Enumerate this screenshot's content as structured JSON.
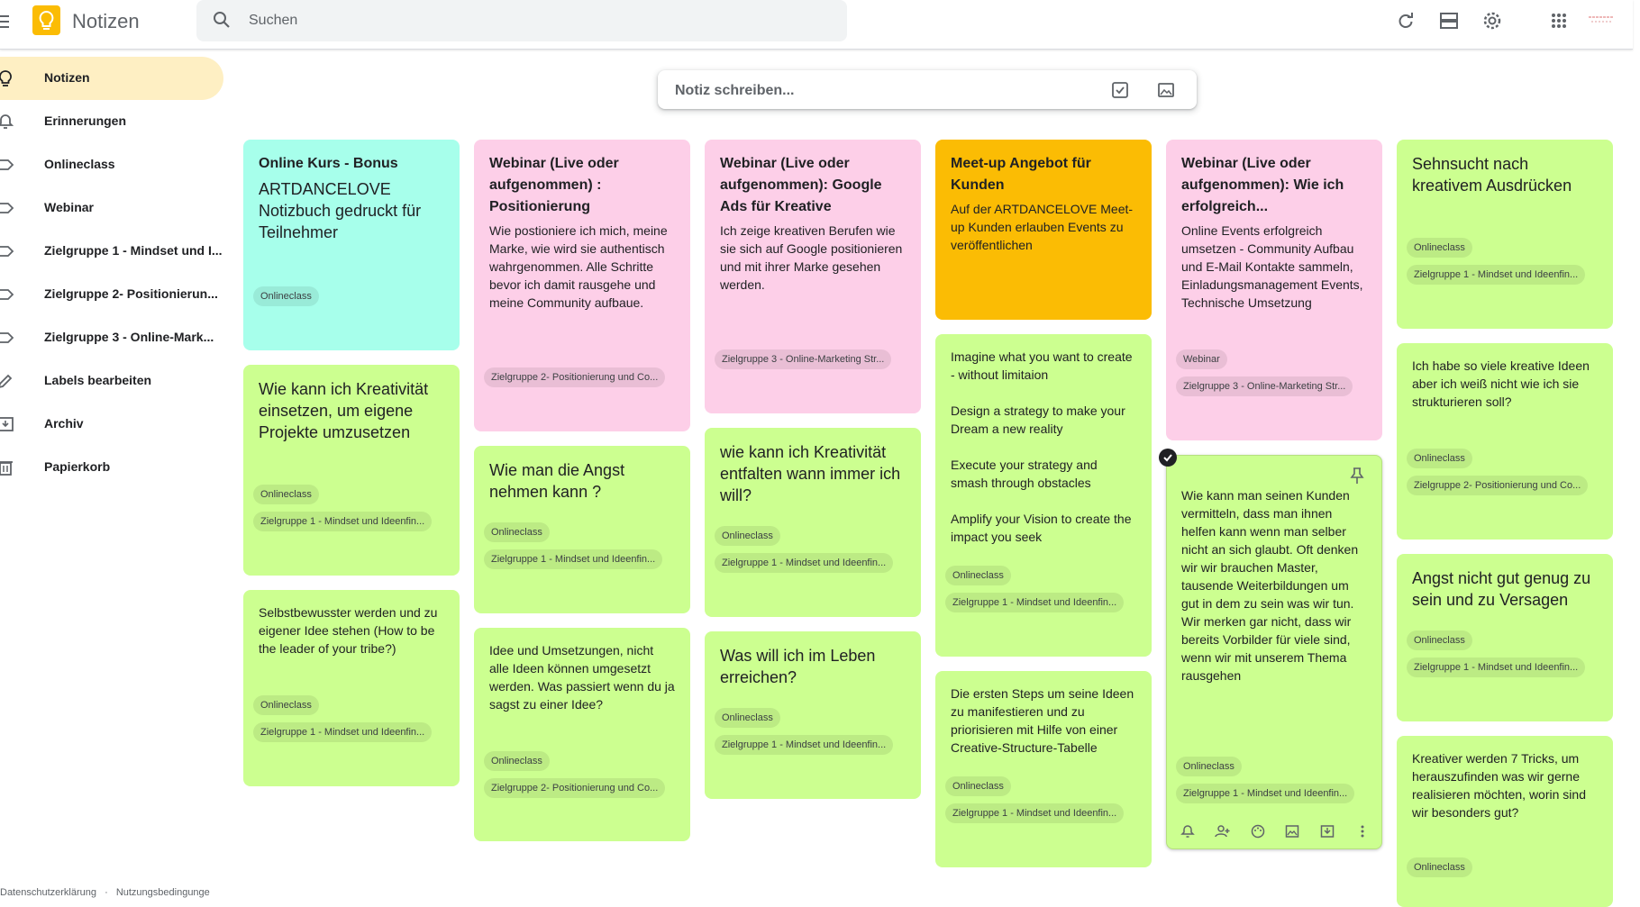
{
  "app": {
    "title": "Notizen"
  },
  "search": {
    "placeholder": "Suchen"
  },
  "take_note": {
    "placeholder": "Notiz schreiben..."
  },
  "sidebar": {
    "items": [
      {
        "label": "Notizen",
        "icon": "lightbulb-icon",
        "active": true
      },
      {
        "label": "Erinnerungen",
        "icon": "bell-icon"
      },
      {
        "label": "Onlineclass",
        "icon": "label-icon"
      },
      {
        "label": "Webinar",
        "icon": "label-icon"
      },
      {
        "label": "Zielgruppe 1 - Mindset und I...",
        "icon": "label-icon"
      },
      {
        "label": "Zielgruppe 2- Positionierun...",
        "icon": "label-icon"
      },
      {
        "label": "Zielgruppe 3 - Online-Mark...",
        "icon": "label-icon"
      },
      {
        "label": "Labels bearbeiten",
        "icon": "pencil-icon"
      },
      {
        "label": "Archiv",
        "icon": "archive-icon"
      },
      {
        "label": "Papierkorb",
        "icon": "trash-icon"
      }
    ]
  },
  "footer": {
    "privacy": "Datenschutzerklärung",
    "separator": "·",
    "terms": "Nutzungsbedingunge"
  },
  "notes": [
    {
      "title": "Online Kurs - Bonus",
      "text": "ARTDANCELOVE Notizbuch gedruckt für Teilnehmer",
      "labels": [
        "Onlineclass"
      ],
      "color": "#a7ffeb"
    },
    {
      "title": "Webinar (Live oder aufgenommen) : Positionierung",
      "text": "Wie postioniere ich mich, meine Marke, wie wird sie authentisch wahrgenommen. Alle Schritte bevor ich damit rausgehe und meine Community aufbaue.",
      "labels": [
        "Zielgruppe 2- Positionierung und Co..."
      ],
      "color": "#fdcfe8"
    },
    {
      "title": "Webinar (Live oder aufgenommen): Google Ads für Kreative",
      "text": "Ich zeige kreativen Berufen wie sie sich auf Google positionieren und mit ihrer Marke gesehen werden.",
      "labels": [
        "Zielgruppe 3 - Online-Marketing Str..."
      ],
      "color": "#fdcfe8"
    },
    {
      "title": "Meet-up Angebot für Kunden",
      "text": "Auf der ARTDANCELOVE Meet-up Kunden erlauben Events zu veröffentlichen",
      "labels": [],
      "color": "#fbbc04"
    },
    {
      "title": "Webinar (Live oder aufgenommen): Wie ich erfolgreich...",
      "text": "Online Events erfolgreich umsetzen - Community Aufbau und E-Mail Kontakte sammeln, Einladungsmanagement Events, Technische Umsetzung",
      "labels": [
        "Webinar",
        "Zielgruppe 3 - Online-Marketing Str..."
      ],
      "color": "#fdcfe8"
    },
    {
      "title": "Sehnsucht nach kreativem Ausdrücken",
      "text": "",
      "labels": [
        "Onlineclass",
        "Zielgruppe 1 - Mindset und Ideenfin..."
      ],
      "color": "#ccff90"
    },
    {
      "title": "",
      "text": "Wie kann ich Kreativität einsetzen, um eigene Projekte umzusetzen",
      "labels": [
        "Onlineclass",
        "Zielgruppe 1 - Mindset und Ideenfin..."
      ],
      "color": "#ccff90"
    },
    {
      "title": "",
      "text": "Wie man die Angst nehmen kann ?",
      "labels": [
        "Onlineclass",
        "Zielgruppe 1 - Mindset und Ideenfin..."
      ],
      "color": "#ccff90"
    },
    {
      "title": "",
      "text": "wie kann ich Kreativität entfalten wann immer ich will?",
      "labels": [
        "Onlineclass",
        "Zielgruppe 1 - Mindset und Ideenfin..."
      ],
      "color": "#ccff90"
    },
    {
      "title": "",
      "text": "Imagine what you want to create - without limitaion\n\nDesign a strategy to make your Dream a new reality\n\nExecute your strategy and smash through obstacles\n\nAmplify your Vision to create the impact you seek",
      "labels": [
        "Onlineclass",
        "Zielgruppe 1 - Mindset und Ideenfin..."
      ],
      "color": "#ccff90"
    },
    {
      "title": "",
      "text": "Wie kann man seinen Kunden vermitteln, dass man ihnen helfen kann wenn man selber nicht an sich glaubt. Oft denken wir wir brauchen Master, tausende Weiterbildungen um gut in dem zu sein was wir tun. Wir merken gar nicht, dass wir bereits Vorbilder für viele sind, wenn wir mit unserem Thema rausgehen",
      "labels": [
        "Onlineclass",
        "Zielgruppe 1 - Mindset und Ideenfin..."
      ],
      "color": "#ccff90"
    },
    {
      "title": "",
      "text": "Ich habe so viele kreative Ideen aber ich weiß nicht wie ich sie strukturieren soll?",
      "labels": [
        "Onlineclass",
        "Zielgruppe 2- Positionierung und Co..."
      ],
      "color": "#ccff90"
    },
    {
      "title": "",
      "text": "Selbstbewusster werden und zu eigener Idee stehen (How to be the leader of your tribe?)",
      "labels": [
        "Onlineclass",
        "Zielgruppe 1 - Mindset und Ideenfin..."
      ],
      "color": "#ccff90"
    },
    {
      "title": "",
      "text": "Idee und Umsetzungen, nicht alle Ideen können umgesetzt werden. Was passiert wenn du ja sagst zu einer Idee?",
      "labels": [
        "Onlineclass",
        "Zielgruppe 2- Positionierung und Co..."
      ],
      "color": "#ccff90"
    },
    {
      "title": "",
      "text": "Was will ich im Leben erreichen?",
      "labels": [
        "Onlineclass",
        "Zielgruppe 1 - Mindset und Ideenfin..."
      ],
      "color": "#ccff90"
    },
    {
      "title": "",
      "text": "Die ersten Steps um seine Ideen zu manifestieren und zu priorisieren mit Hilfe von einer Creative-Structure-Tabelle",
      "labels": [
        "Onlineclass",
        "Zielgruppe 1 - Mindset und Ideenfin..."
      ],
      "color": "#ccff90"
    },
    {
      "title": "",
      "text": "Angst nicht gut genug zu sein und zu Versagen",
      "labels": [
        "Onlineclass",
        "Zielgruppe 1 - Mindset und Ideenfin..."
      ],
      "color": "#ccff90"
    },
    {
      "title": "",
      "text": "Kreativer werden 7 Tricks, um herauszufinden was wir gerne realisieren möchten, worin sind wir besonders gut?",
      "labels": [
        "Onlineclass"
      ],
      "color": "#ccff90"
    }
  ]
}
